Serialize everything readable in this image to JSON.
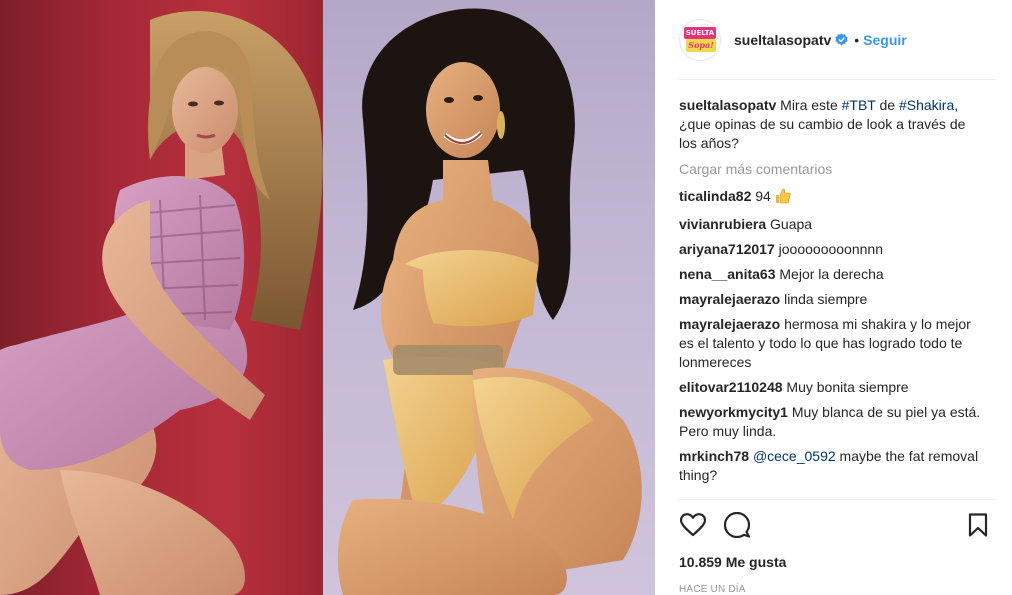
{
  "account": {
    "username": "sueltalasopatv",
    "follow_label": "Seguir",
    "separator": "•",
    "avatar_text_top": "SUELTA",
    "avatar_text_bottom": "Sopa!"
  },
  "caption": {
    "user": "sueltalasopatv",
    "text_before": " Mira este ",
    "hashtag1": "#TBT",
    "text_middle": " de ",
    "hashtag2": "#Shakira",
    "text_after": ", ¿que opinas de su cambio de look a través de los años?"
  },
  "load_more_label": "Cargar más comentarios",
  "comments": [
    {
      "user": "ticalinda82",
      "text": " 94 "
    },
    {
      "user": "vivianrubiera",
      "text": " Guapa"
    },
    {
      "user": "ariyana712017",
      "text": " jooooooooonnnn"
    },
    {
      "user": "nena__anita63",
      "text": " Mejor la derecha"
    },
    {
      "user": "mayralejaerazo",
      "text": " linda siempre"
    },
    {
      "user": "mayralejaerazo",
      "text": " hermosa mi shakira y lo mejor es el talento y todo lo que has logrado todo te lonmereces"
    },
    {
      "user": "elitovar2110248",
      "text": " Muy bonita siempre"
    },
    {
      "user": "newyorkmycity1",
      "text": " Muy blanca de su piel ya está. Pero muy linda."
    },
    {
      "user": "mrkinch78",
      "mention": "@cece_0592",
      "text": " maybe the fat removal thing?"
    }
  ],
  "likes_label": "10.859 Me gusta",
  "timestamp": "HACE UN DÍA",
  "icons": {
    "verified": "verified-badge-icon",
    "like": "heart-icon",
    "comment": "comment-bubble-icon",
    "save": "bookmark-icon",
    "thumbs_up": "thumbs-up-emoji"
  },
  "colors": {
    "link_blue": "#3897f0",
    "hashtag": "#003569",
    "muted": "#999999",
    "text": "#262626",
    "brand_pink": "#e5337f",
    "brand_yellow": "#f1d84a"
  }
}
